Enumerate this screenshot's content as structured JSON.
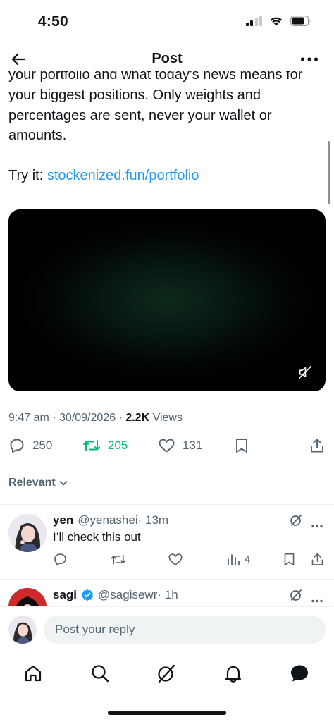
{
  "status_bar": {
    "time": "4:50"
  },
  "header": {
    "title": "Post"
  },
  "tweet": {
    "line_partial": "your portfolio and what today's news means for",
    "line2": "your biggest positions. Only weights and",
    "line3": "percentages are sent, never your wallet or",
    "line4": "amounts.",
    "try_label": "Try it: ",
    "link": "stockenized.fun/portfolio"
  },
  "meta": {
    "time_date": "9:47 am · 30/09/2026 · ",
    "views_count": "2.2K",
    "views_label": " Views"
  },
  "actions": {
    "replies": "250",
    "reposts": "205",
    "likes": "131"
  },
  "sort": {
    "label": "Relevant"
  },
  "replies": [
    {
      "name": "yen",
      "handle": "@yenashei",
      "time": "· 13m",
      "text": "I’ll check this out",
      "views": "4"
    },
    {
      "name": "sagi",
      "handle": "@sagisewr",
      "time": "· 1h"
    }
  ],
  "composer": {
    "placeholder": "Post your reply"
  },
  "colors": {
    "accent": "#1d9bf0",
    "repost_green": "#00ba7c",
    "muted": "#536471",
    "text": "#0f1419"
  }
}
